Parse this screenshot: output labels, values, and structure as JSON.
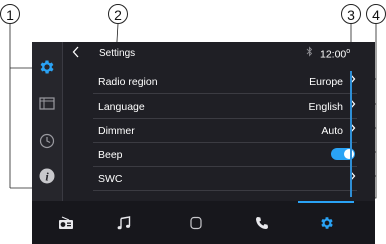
{
  "callouts": [
    "1",
    "2",
    "3",
    "4"
  ],
  "header": {
    "back_icon": "chevron-left-icon",
    "title": "Settings",
    "bluetooth_icon": "bluetooth-icon",
    "clock": "12:00"
  },
  "sidebar": {
    "items": [
      {
        "icon": "gear-icon",
        "active": true
      },
      {
        "icon": "display-icon",
        "active": false
      },
      {
        "icon": "clock-icon",
        "active": false
      },
      {
        "icon": "info-icon",
        "active": false
      }
    ]
  },
  "settings": {
    "rows": [
      {
        "label": "Radio region",
        "value": "Europe"
      },
      {
        "label": "Language",
        "value": "English"
      },
      {
        "label": "Dimmer",
        "value": "Auto"
      },
      {
        "label": "Beep",
        "value": "",
        "toggle_on": true
      },
      {
        "label": "SWC",
        "value": ""
      }
    ]
  },
  "bottom_nav": {
    "items": [
      {
        "icon": "radio-icon"
      },
      {
        "icon": "music-note-icon"
      },
      {
        "icon": "home-icon"
      },
      {
        "icon": "phone-icon"
      },
      {
        "icon": "gear-icon",
        "active": true
      }
    ]
  },
  "colors": {
    "accent": "#2aa3f5",
    "background": "#1f1f25",
    "text": "#ffffff"
  }
}
